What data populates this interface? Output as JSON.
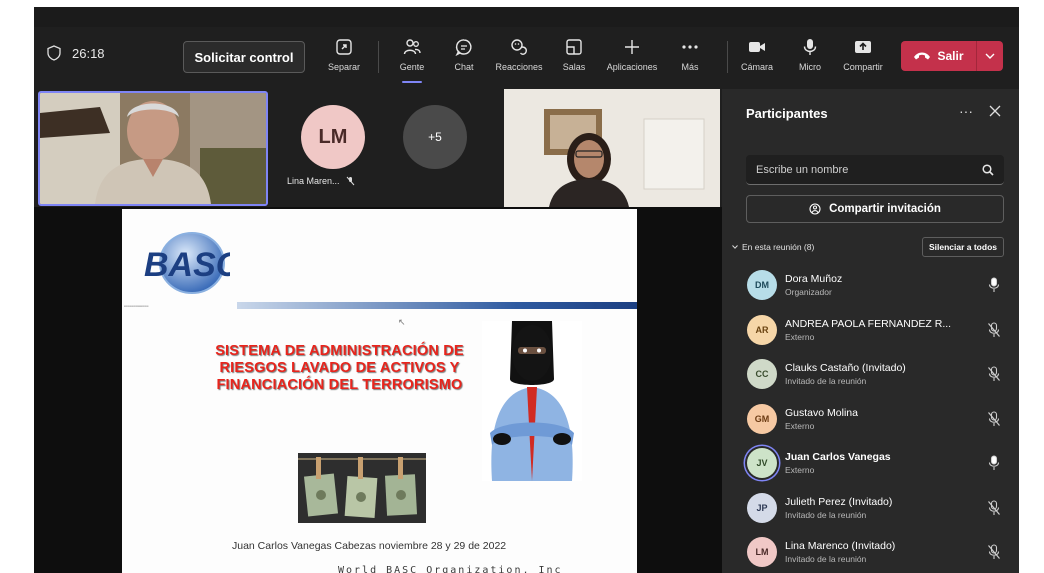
{
  "toolbar": {
    "timer": "26:18",
    "request_control": "Solicitar control",
    "tools": [
      {
        "label": "Separar",
        "icon": "pop-out-icon"
      },
      {
        "label": "Gente",
        "icon": "people-icon",
        "active": true
      },
      {
        "label": "Chat",
        "icon": "chat-icon"
      },
      {
        "label": "Reacciones",
        "icon": "reactions-icon"
      },
      {
        "label": "Salas",
        "icon": "rooms-icon"
      },
      {
        "label": "Aplicaciones",
        "icon": "plus-icon"
      },
      {
        "label": "Más",
        "icon": "more-icon"
      },
      {
        "label": "Cámara",
        "icon": "camera-icon"
      },
      {
        "label": "Micro",
        "icon": "mic-icon"
      },
      {
        "label": "Compartir",
        "icon": "share-icon"
      }
    ],
    "leave_label": "Salir"
  },
  "strip": {
    "avatar_initials": "LM",
    "avatar_name": "Lina Maren...",
    "overflow_count": "+5"
  },
  "slide": {
    "logo_text": "BASC",
    "title": "SISTEMA DE ADMINISTRACIÓN DE RIESGOS LAVADO DE ACTIVOS Y FINANCIACIÓN DEL TERRORISMO",
    "presenter_line": "Juan Carlos Vanegas Cabezas noviembre 28 y 29 de 2022",
    "footer": "World BASC Organization, Inc"
  },
  "panel": {
    "title": "Participantes",
    "search_placeholder": "Escribe un nombre",
    "share_invite": "Compartir invitación",
    "section_label": "En esta reunión (8)",
    "mute_all": "Silenciar a todos",
    "participants": [
      {
        "initials": "DM",
        "name": "Dora Muñoz",
        "role": "Organizador",
        "mic": "on",
        "color": "#b7dde8",
        "text": "#1d4a5a"
      },
      {
        "initials": "AR",
        "name": "ANDREA PAOLA FERNANDEZ R...",
        "role": "Externo",
        "mic": "off",
        "color": "#f6d6a8",
        "text": "#6a4311"
      },
      {
        "initials": "CC",
        "name": "Clauks Castaño (Invitado)",
        "role": "Invitado de la reunión",
        "mic": "off",
        "color": "#cfd9c8",
        "text": "#3a4d2e"
      },
      {
        "initials": "GM",
        "name": "Gustavo Molina",
        "role": "Externo",
        "mic": "off",
        "color": "#f6c9a3",
        "text": "#6b3a12"
      },
      {
        "initials": "JV",
        "name": "Juan Carlos Vanegas",
        "role": "Externo",
        "mic": "on",
        "color": "#cde3c8",
        "text": "#2f4a28",
        "speaking": true
      },
      {
        "initials": "JP",
        "name": "Julieth Perez (Invitado)",
        "role": "Invitado de la reunión",
        "mic": "off",
        "color": "#d4dae8",
        "text": "#2d3955"
      },
      {
        "initials": "LM",
        "name": "Lina Marenco (Invitado)",
        "role": "Invitado de la reunión",
        "mic": "off",
        "color": "#f0c8c6",
        "text": "#4a2a28"
      }
    ]
  },
  "colors": {
    "accent": "#7f85f5",
    "leave": "#c4314b",
    "slide_title": "#e8241c"
  }
}
